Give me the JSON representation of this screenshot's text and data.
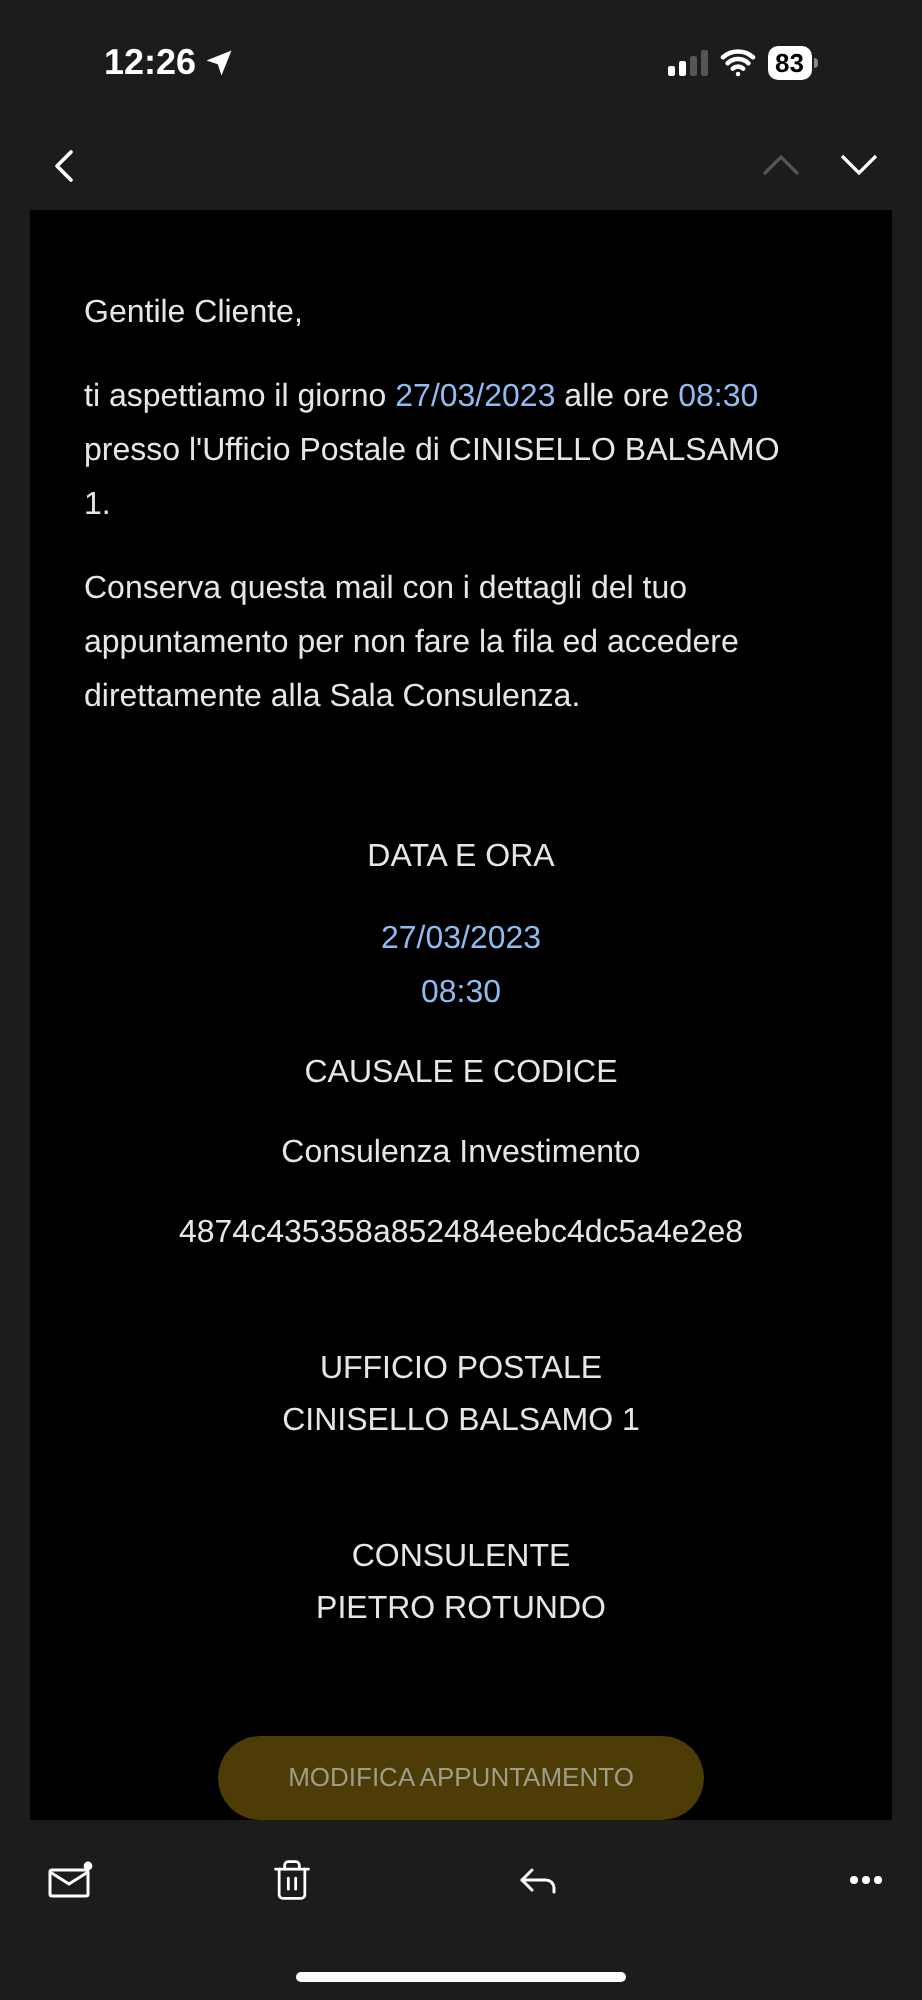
{
  "status_bar": {
    "time": "12:26",
    "battery": "83"
  },
  "nav": {
    "previous": {
      "disabled": true
    },
    "next": {
      "disabled": false
    }
  },
  "email": {
    "greeting": "Gentile Cliente,",
    "paragraphs": [
      [
        {
          "kind": "plain",
          "text": "ti aspettiamo il giorno "
        },
        {
          "kind": "link",
          "text": "27/03/2023"
        },
        {
          "kind": "plain",
          "text": " alle ore "
        },
        {
          "kind": "link",
          "text": "08:30"
        },
        {
          "kind": "plain",
          "text": " presso l'Ufficio Postale di CINISELLO BALSAMO 1."
        }
      ],
      [
        {
          "kind": "plain",
          "text": "Conserva questa mail con i dettagli del tuo appuntamento per non fare la fila ed accedere direttamente alla Sala Consulenza."
        }
      ]
    ],
    "sections": [
      {
        "kind": "spaced",
        "heading": "DATA E ORA",
        "lines": [
          {
            "kind": "link",
            "text": "27/03/2023"
          },
          {
            "kind": "link",
            "text": "08:30"
          }
        ]
      },
      {
        "kind": "spaced",
        "heading": "CAUSALE E CODICE",
        "lines": [
          {
            "kind": "plain",
            "text": "Consulenza Investimento"
          },
          {
            "kind": "plain",
            "text": "4874c435358a852484eebc4dc5a4e2e8"
          }
        ]
      },
      {
        "kind": "stacked",
        "heading": "UFFICIO POSTALE",
        "lines": [
          {
            "kind": "plain",
            "text": "CINISELLO BALSAMO 1"
          }
        ]
      },
      {
        "kind": "stacked",
        "heading": "CONSULENTE",
        "lines": [
          {
            "kind": "plain",
            "text": "PIETRO ROTUNDO"
          }
        ]
      }
    ],
    "button": "MODIFICA APPUNTAMENTO"
  }
}
